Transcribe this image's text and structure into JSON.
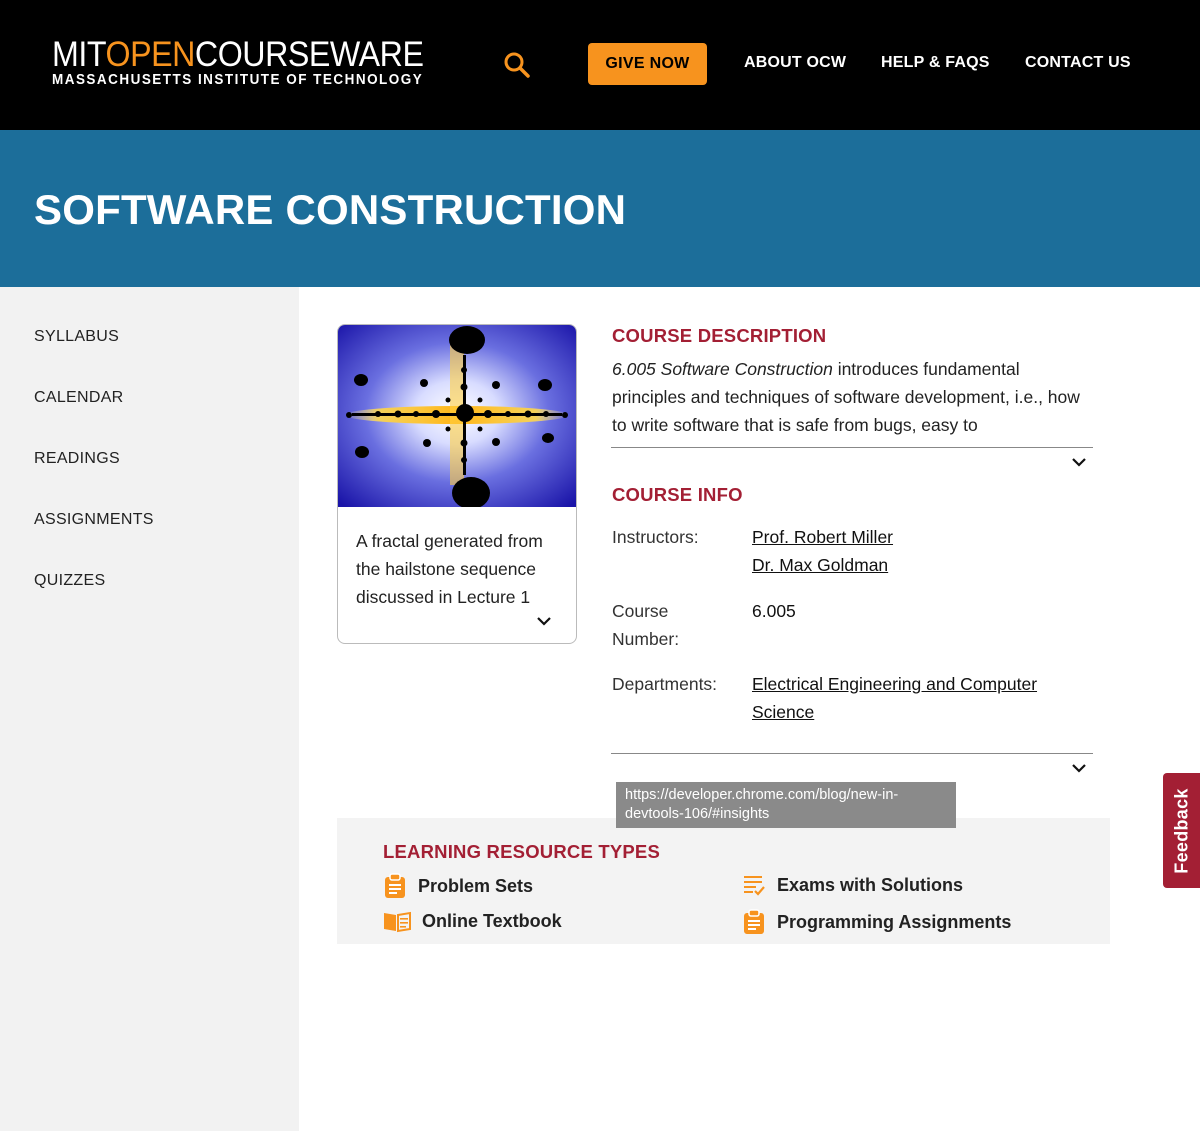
{
  "header": {
    "logo_part1": "MIT",
    "logo_part2": "OPEN",
    "logo_part3": "COURSEWARE",
    "logo_subtitle": "MASSACHUSETTS INSTITUTE OF TECHNOLOGY",
    "search_icon": "search-icon",
    "give_now": "GIVE NOW",
    "nav": [
      "ABOUT OCW",
      "HELP & FAQS",
      "CONTACT US"
    ],
    "brand_orange": "#f7931e"
  },
  "banner": {
    "title": "SOFTWARE CONSTRUCTION",
    "background": "#1c6e9a"
  },
  "sidebar": {
    "items": [
      "SYLLABUS",
      "CALENDAR",
      "READINGS",
      "ASSIGNMENTS",
      "QUIZZES"
    ]
  },
  "image_card": {
    "caption": "A fractal generated from the hailstone sequence discussed in Lecture 1"
  },
  "course_description": {
    "title": "COURSE DESCRIPTION",
    "course_name_italic": "6.005 Software Construction",
    "text": " introduces fundamental principles and techniques of software development, i.e., how to write software that is safe from bugs, easy to"
  },
  "course_info": {
    "title": "COURSE INFO",
    "instructors_label": "Instructors:",
    "instructors": [
      "Prof. Robert Miller",
      "Dr. Max Goldman"
    ],
    "course_number_label_1": "Course",
    "course_number_label_2": "Number:",
    "course_number": "6.005",
    "departments_label": "Departments:",
    "department_line1": "Electrical Engineering and Computer",
    "department_line2": "Science"
  },
  "tooltip": {
    "line1": "https://developer.chrome.com/blog/new-in-",
    "line2": "devtools-106/#insights"
  },
  "learning_resources": {
    "title": "LEARNING RESOURCE TYPES",
    "items": [
      {
        "label": "Problem Sets",
        "icon": "clipboard-icon"
      },
      {
        "label": "Exams with Solutions",
        "icon": "checklist-icon"
      },
      {
        "label": "Online Textbook",
        "icon": "open-book-icon"
      },
      {
        "label": "Programming Assignments",
        "icon": "clipboard-icon"
      }
    ]
  },
  "feedback": {
    "label": "Feedback",
    "color": "#a31f34"
  },
  "accent_red": "#a31f34"
}
